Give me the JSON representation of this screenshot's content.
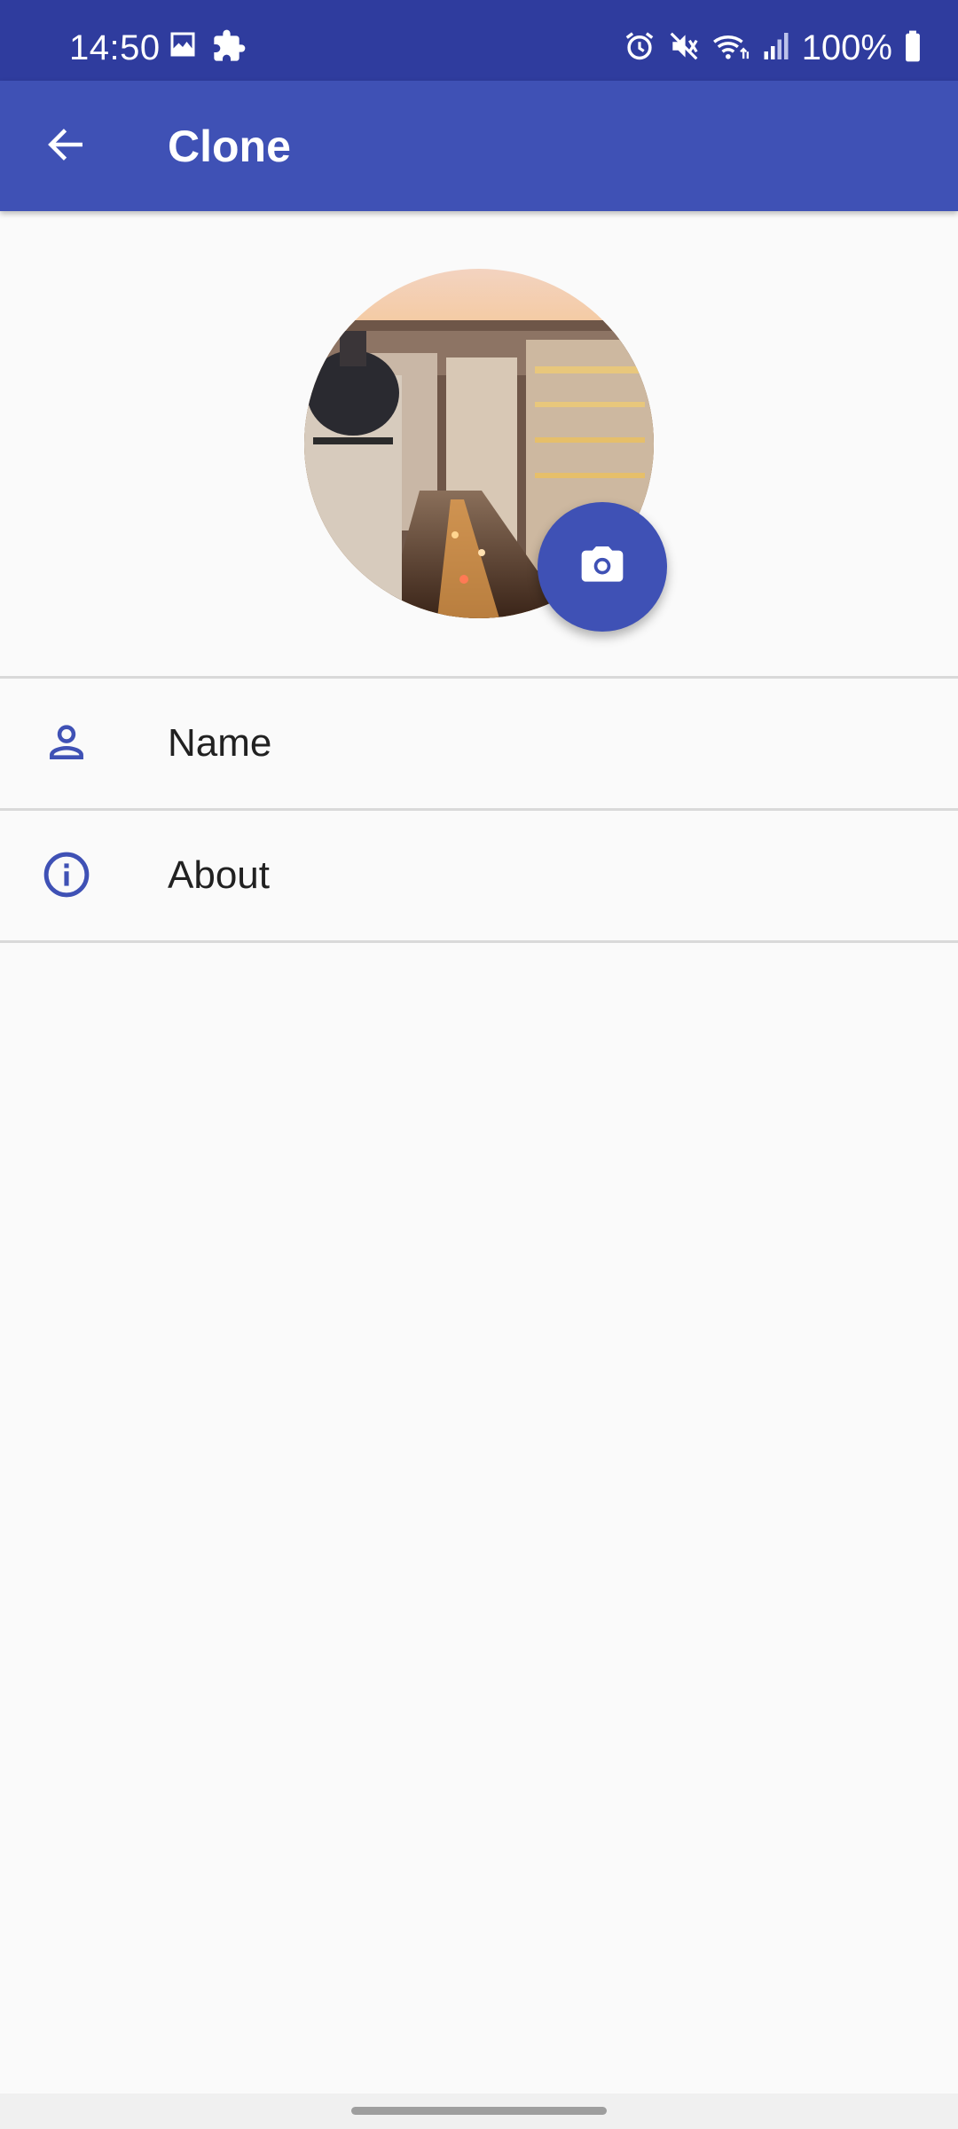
{
  "status_bar": {
    "time": "14:50",
    "battery_text": "100%",
    "left_icons": [
      "image-icon",
      "puzzle-icon"
    ],
    "right_icons": [
      "alarm-icon",
      "mute-icon",
      "wifi-icon",
      "signal-icon",
      "battery-icon"
    ]
  },
  "app_bar": {
    "title": "Clone",
    "back_icon": "arrow-back-icon"
  },
  "profile": {
    "avatar": "city-street-photo",
    "camera_icon": "camera-icon"
  },
  "list": {
    "items": [
      {
        "label": "Name",
        "icon": "person-icon"
      },
      {
        "label": "About",
        "icon": "info-icon"
      }
    ]
  },
  "colors": {
    "status_bar": "#2f3c9e",
    "primary": "#3f51b5",
    "background": "#fafafa",
    "text": "#212121",
    "divider": "#d9d9d9"
  }
}
